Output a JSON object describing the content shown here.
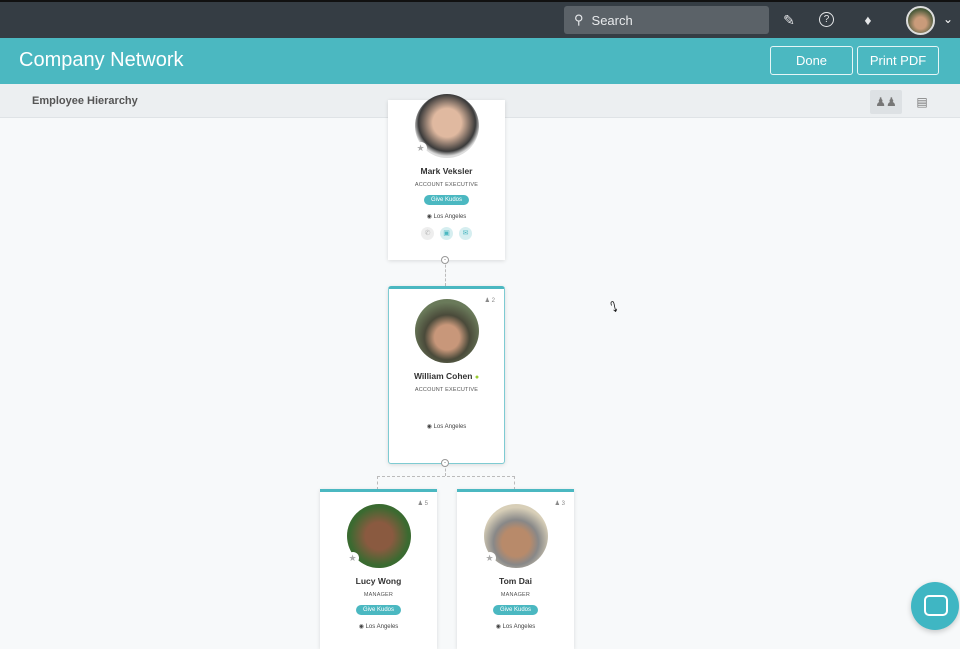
{
  "topbar": {
    "search_placeholder": "Search",
    "icons": [
      "wrench-icon",
      "help-icon",
      "bell-icon"
    ]
  },
  "header": {
    "title": "Company Network",
    "done": "Done",
    "print": "Print PDF"
  },
  "subbar": {
    "title": "Employee Hierarchy"
  },
  "colors": {
    "accent": "#4bb8c1",
    "topbar": "#353d44"
  },
  "cards": [
    {
      "name": "Mark Veksler",
      "role": "ACCOUNT EXECUTIVE",
      "kudos": "Give Kudos",
      "location": "Los Angeles"
    },
    {
      "name": "William Cohen",
      "role": "ACCOUNT EXECUTIVE",
      "location": "Los Angeles",
      "reports": "2"
    },
    {
      "name": "Lucy Wong",
      "role": "MANAGER",
      "kudos": "Give Kudos",
      "location": "Los Angeles",
      "reports": "5"
    },
    {
      "name": "Tom Dai",
      "role": "MANAGER",
      "kudos": "Give Kudos",
      "location": "Los Angeles",
      "reports": "3"
    }
  ]
}
